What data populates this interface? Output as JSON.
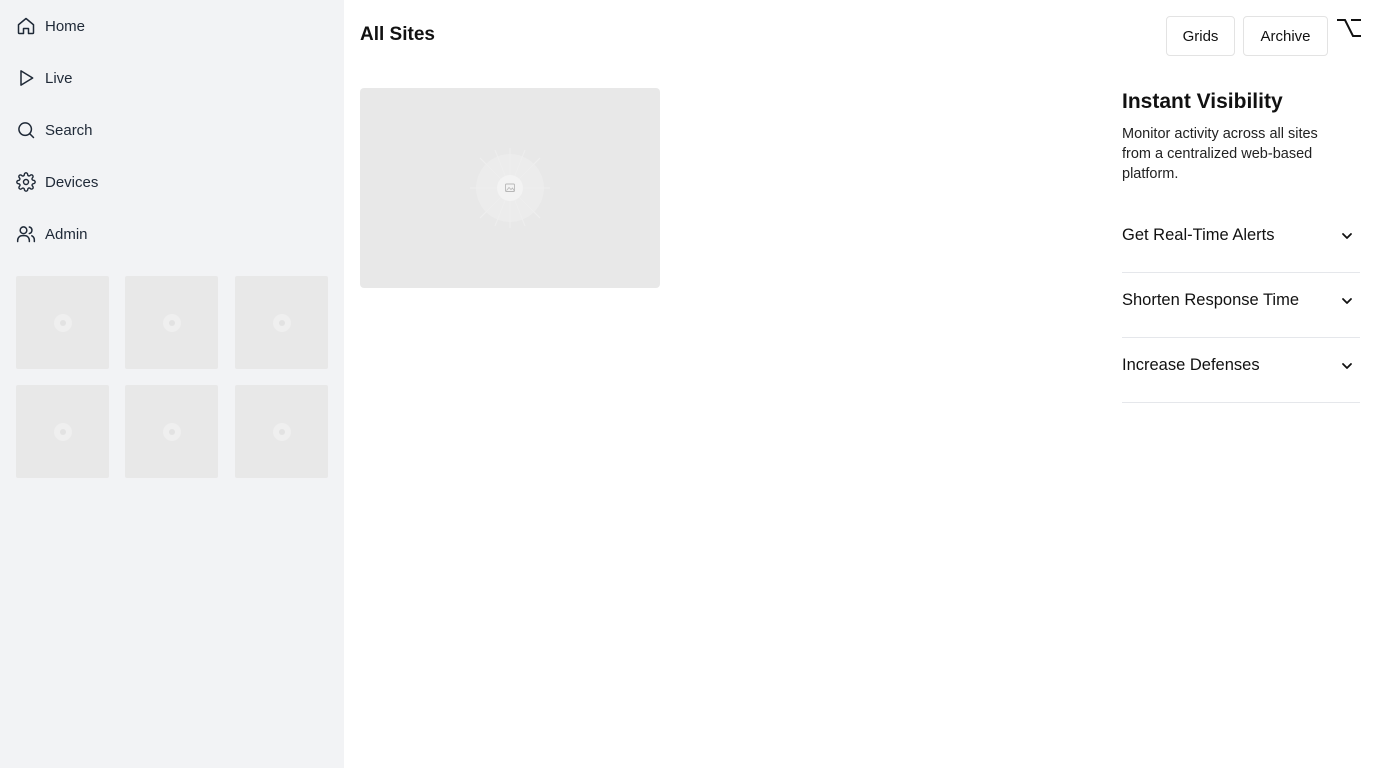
{
  "sidebar": {
    "nav": [
      {
        "label": "Home",
        "icon": "home-icon"
      },
      {
        "label": "Live",
        "icon": "play-icon"
      },
      {
        "label": "Search",
        "icon": "search-icon"
      },
      {
        "label": "Devices",
        "icon": "gear-icon"
      },
      {
        "label": "Admin",
        "icon": "users-icon"
      }
    ],
    "thumbnails_count": 6
  },
  "header": {
    "title": "All Sites",
    "grids_button": "Grids",
    "archive_button": "Archive",
    "option_icon": "option-key-icon"
  },
  "promo": {
    "title": "Instant Visibility",
    "description": "Monitor activity across all sites from a centralized web-based platform.",
    "accordion": [
      {
        "label": "Get Real-Time Alerts"
      },
      {
        "label": "Shorten Response Time"
      },
      {
        "label": "Increase Defenses"
      }
    ]
  },
  "colors": {
    "sidebar_bg": "#f2f3f5",
    "placeholder_bg": "#e8e8e8",
    "divider": "#e5e7eb",
    "text": "#111111"
  }
}
